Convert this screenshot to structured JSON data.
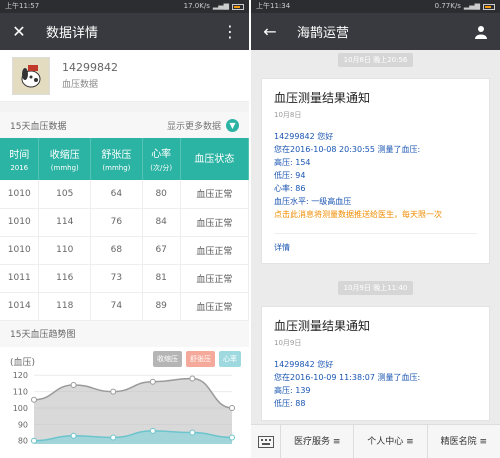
{
  "left": {
    "status": {
      "time": "上午11:57",
      "net": "17.0K/s"
    },
    "appbar": {
      "title": "数据详情"
    },
    "profile": {
      "id": "14299842",
      "subtitle": "血压数据"
    },
    "section": {
      "title": "15天血压数据",
      "more": "显示更多数据"
    },
    "table": {
      "headers": [
        {
          "main": "时间",
          "sub": "2016"
        },
        {
          "main": "收缩压",
          "sub": "(mmhg)"
        },
        {
          "main": "舒张压",
          "sub": "(mmhg)"
        },
        {
          "main": "心率",
          "sub": "(次/分)"
        },
        {
          "main": "血压状态",
          "sub": ""
        }
      ],
      "rows": [
        [
          "1010",
          "105",
          "64",
          "80",
          "血压正常"
        ],
        [
          "1010",
          "114",
          "76",
          "84",
          "血压正常"
        ],
        [
          "1010",
          "110",
          "68",
          "67",
          "血压正常"
        ],
        [
          "1011",
          "116",
          "73",
          "81",
          "血压正常"
        ],
        [
          "1014",
          "118",
          "74",
          "89",
          "血压正常"
        ]
      ]
    },
    "trend": {
      "title": "15天血压趋势图",
      "ylabel": "(血压)",
      "legend": [
        "收缩压",
        "舒张压",
        "心率"
      ]
    },
    "chart_data": {
      "type": "area",
      "ylabel": "(血压)",
      "yticks": [
        80,
        90,
        100,
        110,
        120
      ],
      "ylim": [
        78,
        125
      ],
      "series": [
        {
          "name": "收缩压",
          "values": [
            105,
            114,
            110,
            116,
            118,
            100
          ],
          "color": "#b9b9b9"
        },
        {
          "name": "舒张压",
          "values": [
            80,
            83,
            82,
            86,
            85,
            82
          ],
          "color": "#8fd3d9"
        }
      ]
    }
  },
  "right": {
    "status": {
      "time": "上午11:34",
      "net": "0.77K/s"
    },
    "appbar": {
      "title": "海鹊运营"
    },
    "timestamps": [
      "10月8日 晚上20:56",
      "10月9日 晚上11:40"
    ],
    "cards": [
      {
        "title": "血压测量结果通知",
        "date": "10月8日",
        "lines": [
          "14299842 您好",
          "您在2016-10-08 20:30:55 测量了血压:",
          "高压: 154",
          "低压: 94",
          "心率: 86",
          "血压水平: 一级高血压"
        ],
        "notice": "点击此消息将测量数据推送给医生，每天限一次",
        "detail": "详情"
      },
      {
        "title": "血压测量结果通知",
        "date": "10月9日",
        "lines": [
          "14299842 您好",
          "您在2016-10-09 11:38:07 测量了血压:",
          "高压: 139",
          "低压: 88"
        ]
      }
    ],
    "menu": [
      "医疗服务",
      "个人中心",
      "精医名院"
    ]
  }
}
